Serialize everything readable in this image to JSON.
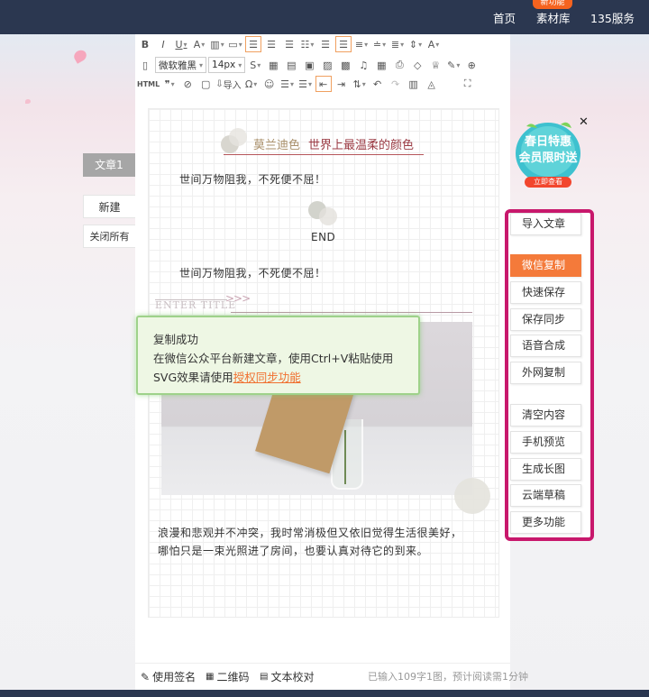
{
  "topnav": {
    "home": "首页",
    "materials": "素材库",
    "service": "135服务",
    "badge": "新功能"
  },
  "left_tabs": {
    "active_doc": "文章1",
    "new": "新建",
    "close_all": "关闭所有"
  },
  "toolbar": {
    "font_family": "微软雅黑",
    "font_size": "14px",
    "html": "HTML",
    "import": "导入"
  },
  "article": {
    "title_part1": "莫兰迪色",
    "title_part2": "世界上最温柔的颜色",
    "line1": "世间万物阻我，不死便不屈！",
    "end": "END",
    "line2": "世间万物阻我，不死便不屈！",
    "enter_title": "ENTER TITLE",
    "para_line1": "浪漫和悲观并不冲突，我时常消极但又依旧觉得生活很美好，",
    "para_line2": "哪怕只是一束光照进了房间，也要认真对待它的到来。"
  },
  "popup": {
    "title": "复制成功",
    "line1": "在微信公众平台新建文章，使用Ctrl+V粘贴使用",
    "line2_prefix": "SVG效果请使用",
    "line2_link": "授权同步功能"
  },
  "promo": {
    "line1": "春日特惠",
    "line2": "会员限时送",
    "cta": "立即查看"
  },
  "sidebar": {
    "import_article": "导入文章",
    "wechat_copy": "微信复制",
    "quick_save": "快速保存",
    "save_sync": "保存同步",
    "voice": "语音合成",
    "external_copy": "外网复制",
    "clear": "清空内容",
    "mobile_preview": "手机预览",
    "long_image": "生成长图",
    "cloud_draft": "云端草稿",
    "more": "更多功能"
  },
  "footer": {
    "signature": "使用签名",
    "qrcode": "二维码",
    "proofread": "文本校对",
    "status": "已输入109字1图，预计阅读需1分钟"
  },
  "colors": {
    "topbar": "#2b3750",
    "accent": "#f47a3a",
    "sidebar_border": "#c8186c",
    "title_dark_red": "#9b3b44",
    "popup_bg": "#eef7e4"
  }
}
